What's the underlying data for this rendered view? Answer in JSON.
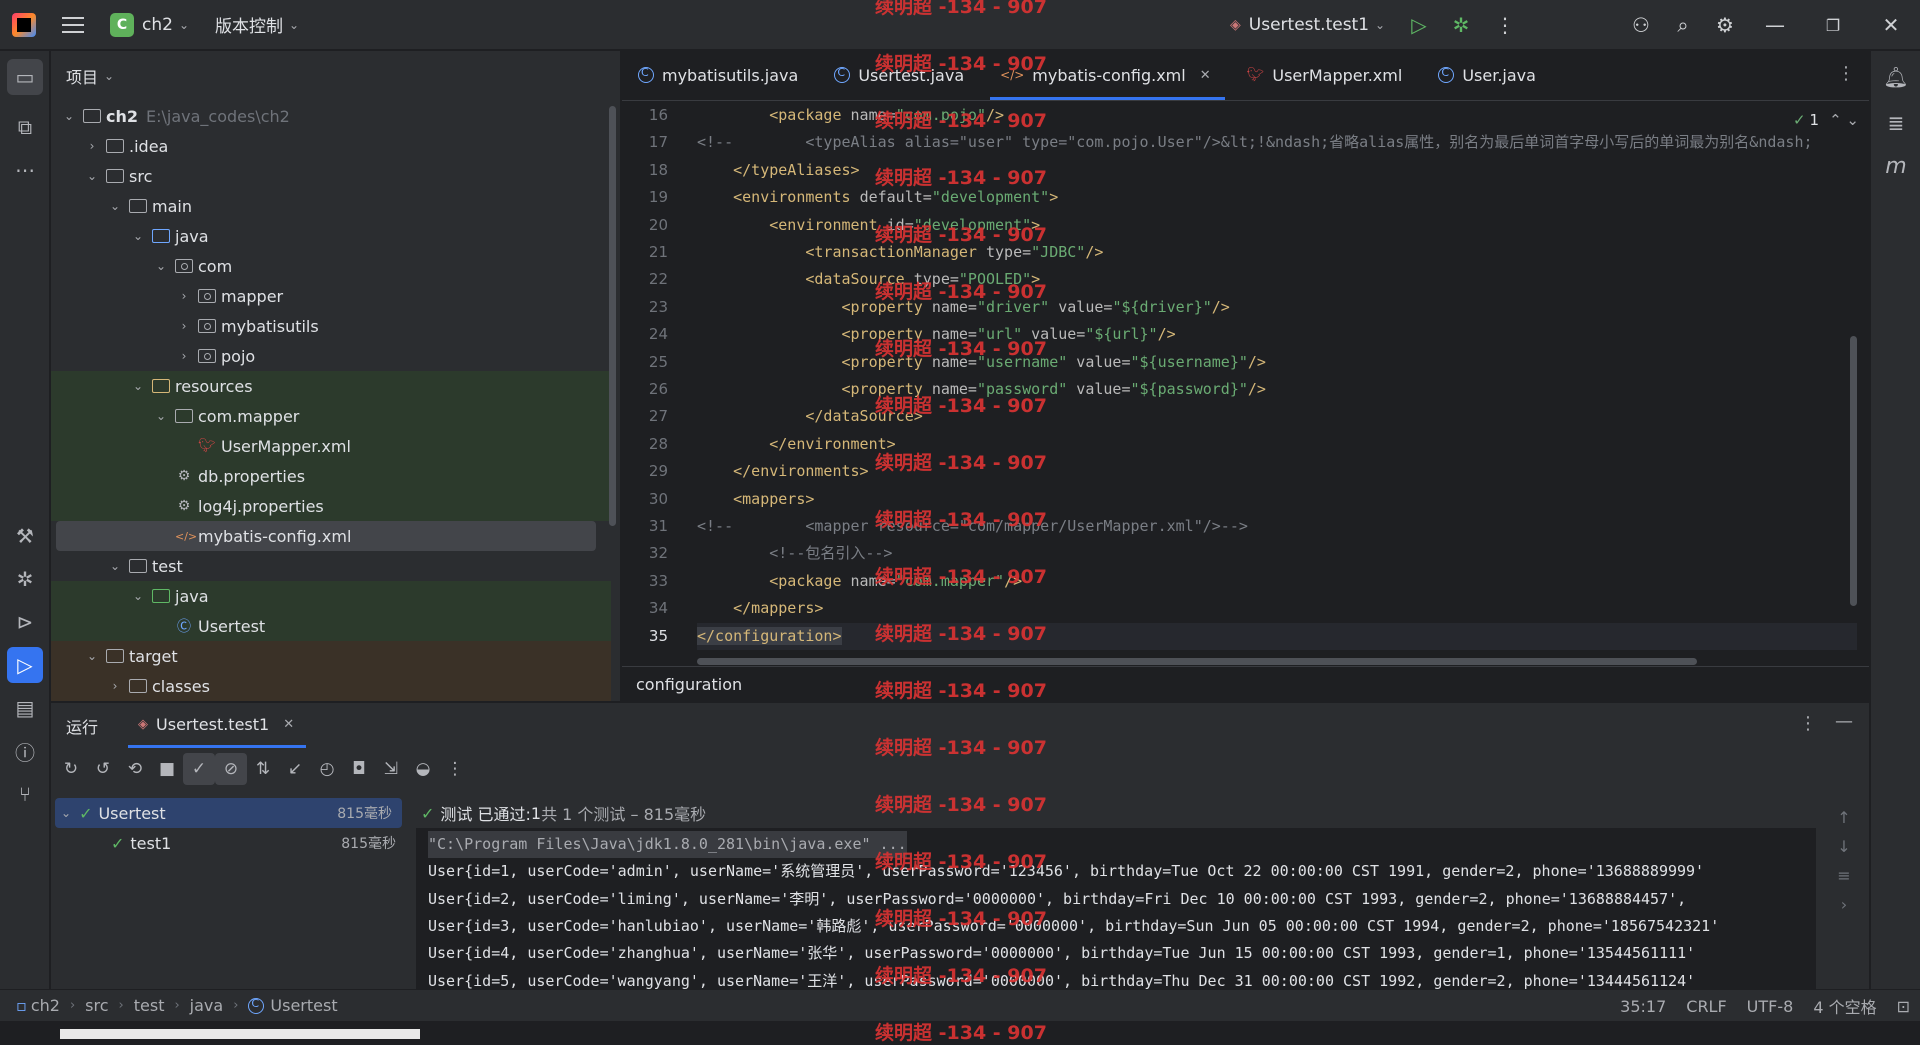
{
  "titlebar": {
    "project_badge": "C",
    "project_name": "ch2",
    "vcs_label": "版本控制",
    "run_config": "Usertest.test1"
  },
  "project_panel": {
    "title": "项目",
    "tree": [
      {
        "label": "ch2",
        "extra": "E:\\java_codes\\ch2",
        "depth": 0,
        "arrow": "⌄",
        "icon": "module",
        "style": "bold"
      },
      {
        "label": ".idea",
        "depth": 1,
        "arrow": "›",
        "icon": "folder"
      },
      {
        "label": "src",
        "depth": 1,
        "arrow": "⌄",
        "icon": "folder"
      },
      {
        "label": "main",
        "depth": 2,
        "arrow": "⌄",
        "icon": "folder"
      },
      {
        "label": "java",
        "depth": 3,
        "arrow": "⌄",
        "icon": "folder-blue"
      },
      {
        "label": "com",
        "depth": 4,
        "arrow": "⌄",
        "icon": "package"
      },
      {
        "label": "mapper",
        "depth": 5,
        "arrow": "›",
        "icon": "package"
      },
      {
        "label": "mybatisutils",
        "depth": 5,
        "arrow": "›",
        "icon": "package"
      },
      {
        "label": "pojo",
        "depth": 5,
        "arrow": "›",
        "icon": "package"
      },
      {
        "label": "resources",
        "depth": 3,
        "arrow": "⌄",
        "icon": "resources",
        "bg": "green"
      },
      {
        "label": "com.mapper",
        "depth": 4,
        "arrow": "⌄",
        "icon": "folder",
        "bg": "green"
      },
      {
        "label": "UserMapper.xml",
        "depth": 5,
        "arrow": "",
        "icon": "mybatis",
        "bg": "green"
      },
      {
        "label": "db.properties",
        "depth": 4,
        "arrow": "",
        "icon": "gear",
        "bg": "green"
      },
      {
        "label": "log4j.properties",
        "depth": 4,
        "arrow": "",
        "icon": "gear",
        "bg": "green"
      },
      {
        "label": "mybatis-config.xml",
        "depth": 4,
        "arrow": "",
        "icon": "xml",
        "bg": "green",
        "selected": true
      },
      {
        "label": "test",
        "depth": 2,
        "arrow": "⌄",
        "icon": "folder"
      },
      {
        "label": "java",
        "depth": 3,
        "arrow": "⌄",
        "icon": "folder-green",
        "bg": "green"
      },
      {
        "label": "Usertest",
        "depth": 4,
        "arrow": "",
        "icon": "class",
        "bg": "green"
      },
      {
        "label": "target",
        "depth": 1,
        "arrow": "⌄",
        "icon": "folder",
        "bg": "brown"
      },
      {
        "label": "classes",
        "depth": 2,
        "arrow": "›",
        "icon": "folder",
        "bg": "brown"
      }
    ]
  },
  "editor": {
    "tabs": [
      {
        "label": "mybatisutils.java",
        "icon": "class"
      },
      {
        "label": "Usertest.java",
        "icon": "class"
      },
      {
        "label": "mybatis-config.xml",
        "icon": "xml",
        "active": true
      },
      {
        "label": "UserMapper.xml",
        "icon": "mybatis"
      },
      {
        "label": "User.java",
        "icon": "class"
      }
    ],
    "inspection_count": "1",
    "lines": [
      {
        "n": "16",
        "indent": 8,
        "segs": [
          [
            "tag",
            "<package "
          ],
          [
            "attr",
            "name="
          ],
          [
            "val",
            "\"com.pojo\""
          ],
          [
            "tag",
            "/>"
          ]
        ]
      },
      {
        "n": "17",
        "indent": 0,
        "segs": [
          [
            "cmt",
            "<!--        <typeAlias alias=\"user\" type=\"com.pojo.User\"/>&lt;!&ndash;省略alias属性，别名为最后单词首字母小写后的单词最为别名&ndash;"
          ]
        ]
      },
      {
        "n": "18",
        "indent": 4,
        "segs": [
          [
            "tag",
            "</typeAliases>"
          ]
        ]
      },
      {
        "n": "19",
        "indent": 4,
        "segs": [
          [
            "tag",
            "<environments "
          ],
          [
            "attr",
            "default="
          ],
          [
            "val",
            "\"development\""
          ],
          [
            "tag",
            ">"
          ]
        ]
      },
      {
        "n": "20",
        "indent": 8,
        "segs": [
          [
            "tag",
            "<environment "
          ],
          [
            "attr",
            "id="
          ],
          [
            "val",
            "\"development\""
          ],
          [
            "tag",
            ">"
          ]
        ]
      },
      {
        "n": "21",
        "indent": 12,
        "segs": [
          [
            "tag",
            "<transactionManager "
          ],
          [
            "attr",
            "type="
          ],
          [
            "val",
            "\"JDBC\""
          ],
          [
            "tag",
            "/>"
          ]
        ]
      },
      {
        "n": "22",
        "indent": 12,
        "segs": [
          [
            "tag",
            "<dataSource "
          ],
          [
            "attr",
            "type="
          ],
          [
            "val",
            "\"POOLED\""
          ],
          [
            "tag",
            ">"
          ]
        ]
      },
      {
        "n": "23",
        "indent": 16,
        "segs": [
          [
            "tag",
            "<property "
          ],
          [
            "attr",
            "name="
          ],
          [
            "val",
            "\"driver\""
          ],
          [
            "attr",
            " value="
          ],
          [
            "val",
            "\"${driver}\""
          ],
          [
            "tag",
            "/>"
          ]
        ]
      },
      {
        "n": "24",
        "indent": 16,
        "segs": [
          [
            "tag",
            "<property "
          ],
          [
            "attr",
            "name="
          ],
          [
            "val",
            "\"url\""
          ],
          [
            "attr",
            " value="
          ],
          [
            "val",
            "\"${url}\""
          ],
          [
            "tag",
            "/>"
          ]
        ]
      },
      {
        "n": "25",
        "indent": 16,
        "segs": [
          [
            "tag",
            "<property "
          ],
          [
            "attr",
            "name="
          ],
          [
            "val",
            "\"username\""
          ],
          [
            "attr",
            " value="
          ],
          [
            "val",
            "\"${username}\""
          ],
          [
            "tag",
            "/>"
          ]
        ]
      },
      {
        "n": "26",
        "indent": 16,
        "segs": [
          [
            "tag",
            "<property "
          ],
          [
            "attr",
            "name="
          ],
          [
            "val",
            "\"password\""
          ],
          [
            "attr",
            " value="
          ],
          [
            "val",
            "\"${password}\""
          ],
          [
            "tag",
            "/>"
          ]
        ]
      },
      {
        "n": "27",
        "indent": 12,
        "segs": [
          [
            "tag",
            "</dataSource>"
          ]
        ]
      },
      {
        "n": "28",
        "indent": 8,
        "segs": [
          [
            "tag",
            "</environment>"
          ]
        ]
      },
      {
        "n": "29",
        "indent": 4,
        "segs": [
          [
            "tag",
            "</environments>"
          ]
        ]
      },
      {
        "n": "30",
        "indent": 4,
        "segs": [
          [
            "tag",
            "<mappers>"
          ]
        ]
      },
      {
        "n": "31",
        "indent": 0,
        "segs": [
          [
            "cmt",
            "<!--        <mapper resource=\"com/mapper/UserMapper.xml\"/>-->"
          ]
        ]
      },
      {
        "n": "32",
        "indent": 8,
        "segs": [
          [
            "cmt",
            "<!--包名引入-->"
          ]
        ]
      },
      {
        "n": "33",
        "indent": 8,
        "segs": [
          [
            "tag",
            "<package "
          ],
          [
            "attr",
            "name="
          ],
          [
            "val",
            "\"com.mapper\""
          ],
          [
            "tag",
            "/>"
          ]
        ]
      },
      {
        "n": "34",
        "indent": 4,
        "segs": [
          [
            "tag",
            "</mappers>"
          ]
        ]
      },
      {
        "n": "35",
        "indent": 0,
        "segs": [
          [
            "tag",
            "</configuration>"
          ]
        ],
        "current": true
      }
    ],
    "breadcrumb": "configuration"
  },
  "run_panel": {
    "title": "运行",
    "tab_label": "Usertest.test1",
    "tests": [
      {
        "label": "Usertest",
        "duration": "815毫秒",
        "selected": true
      },
      {
        "label": "test1",
        "duration": "815毫秒"
      }
    ],
    "summary_prefix": "测试 已通过: ",
    "summary_count": "1",
    "summary_suffix": "共 1 个测试 – 815毫秒",
    "console_lines": [
      "\"C:\\Program Files\\Java\\jdk1.8.0_281\\bin\\java.exe\" ...",
      "User{id=1, userCode='admin', userName='系统管理员', userPassword='123456', birthday=Tue Oct 22 00:00:00 CST 1991, gender=2, phone='13688889999'",
      "User{id=2, userCode='liming', userName='李明', userPassword='0000000', birthday=Fri Dec 10 00:00:00 CST 1993, gender=2, phone='13688884457',",
      "User{id=3, userCode='hanlubiao', userName='韩路彪', userPassword='0000000', birthday=Sun Jun 05 00:00:00 CST 1994, gender=2, phone='18567542321'",
      "User{id=4, userCode='zhanghua', userName='张华', userPassword='0000000', birthday=Tue Jun 15 00:00:00 CST 1993, gender=1, phone='13544561111'",
      "User{id=5, userCode='wangyang', userName='王洋', userPassword='0000000', birthday=Thu Dec 31 00:00:00 CST 1992, gender=2, phone='13444561124'"
    ]
  },
  "statusbar": {
    "crumbs": [
      "ch2",
      "src",
      "test",
      "java",
      "Usertest"
    ],
    "position": "35:17",
    "line_sep": "CRLF",
    "encoding": "UTF-8",
    "indent": "4 个空格"
  },
  "watermark": "续明超 -134 - 907",
  "colors": {
    "accent": "#3574f0",
    "success": "#5fb865",
    "xml_tag": "#d5b778",
    "xml_value": "#6aab73"
  }
}
